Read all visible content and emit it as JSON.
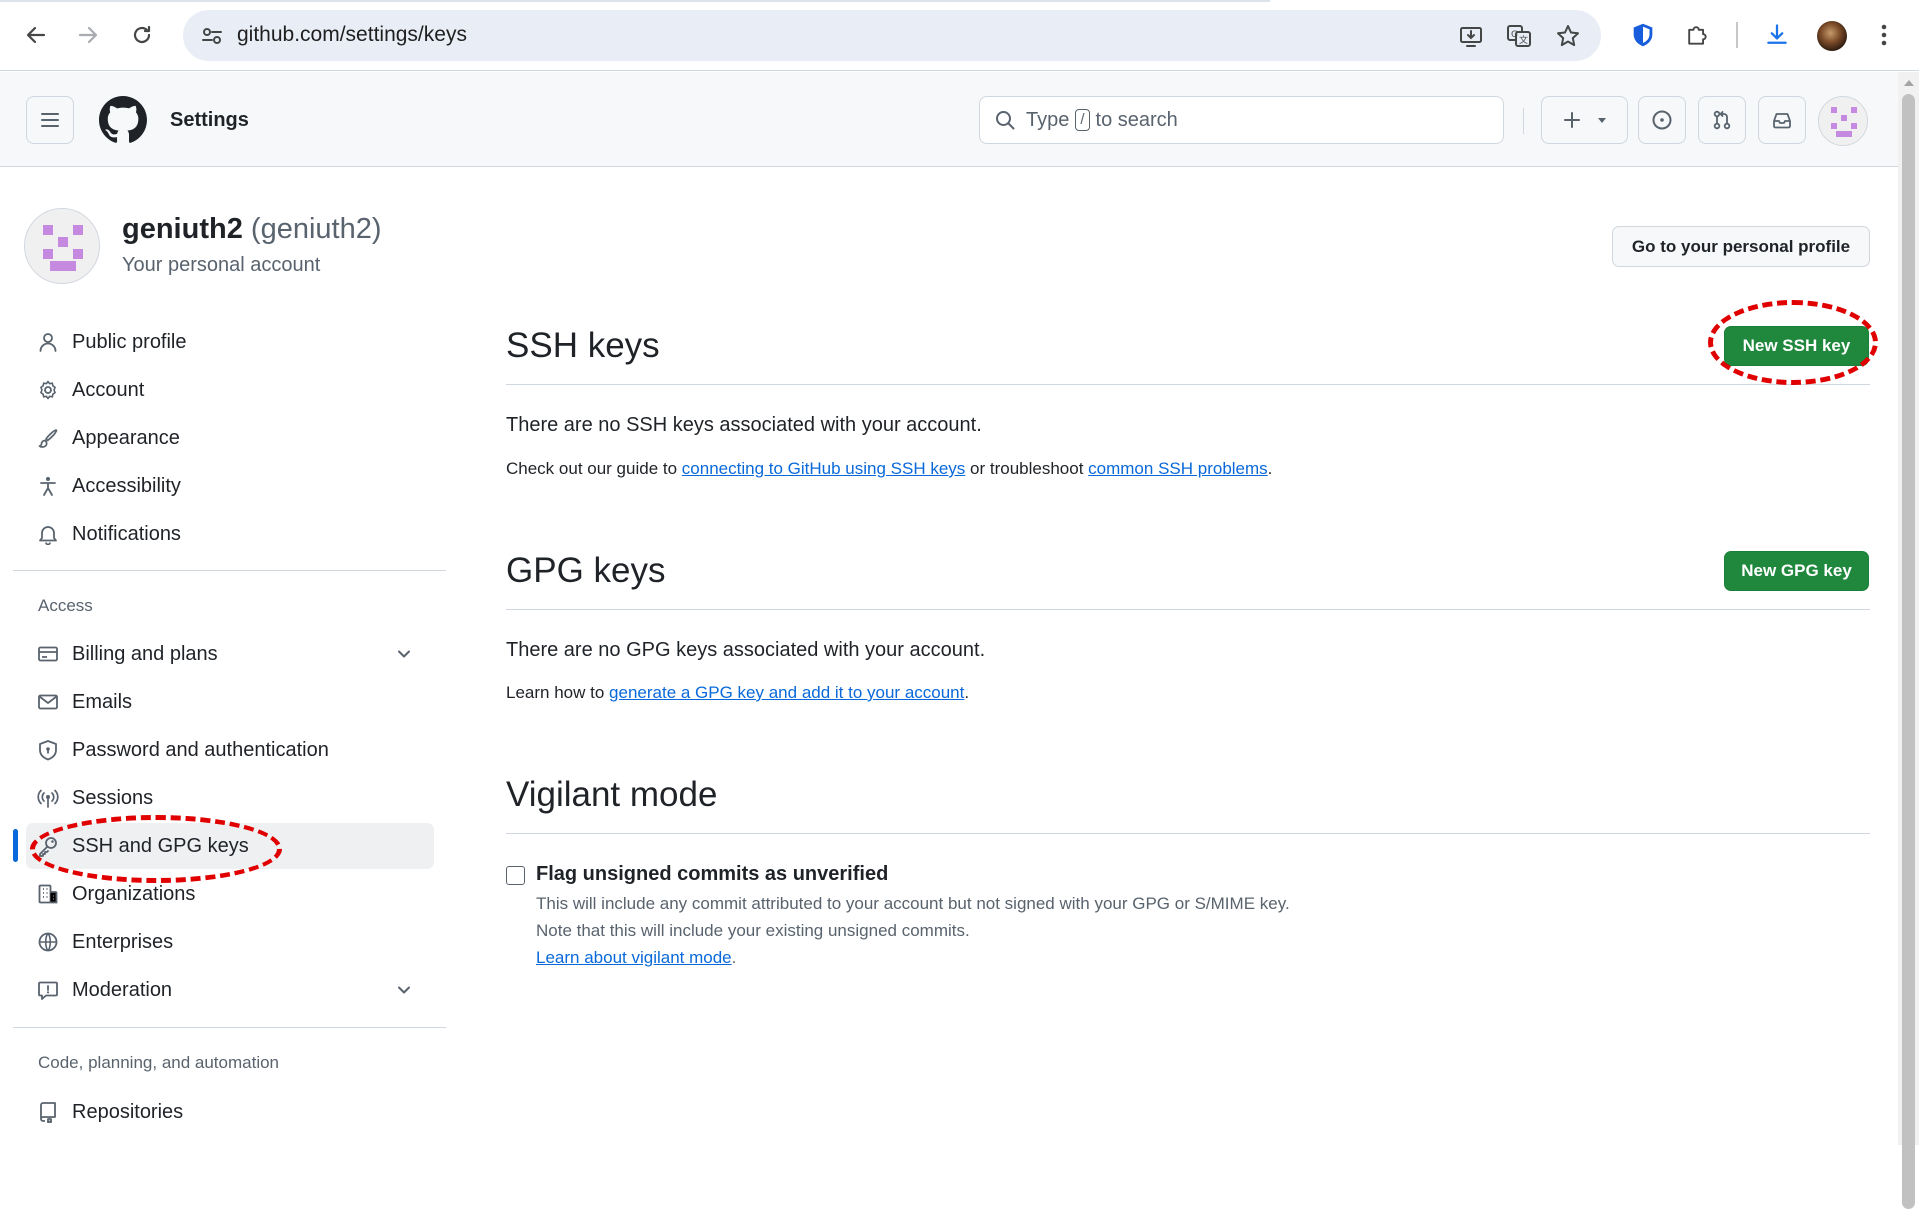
{
  "browser": {
    "url": "github.com/settings/keys"
  },
  "header": {
    "title": "Settings",
    "search_prefix": "Type",
    "search_key": "/",
    "search_suffix": "to search"
  },
  "account": {
    "name": "geniuth2",
    "login": "(geniuth2)",
    "subtitle": "Your personal account",
    "go_profile_label": "Go to your personal profile"
  },
  "sidebar": {
    "items": [
      {
        "label": "Public profile",
        "icon": "person-icon"
      },
      {
        "label": "Account",
        "icon": "gear-icon"
      },
      {
        "label": "Appearance",
        "icon": "paintbrush-icon"
      },
      {
        "label": "Accessibility",
        "icon": "accessibility-icon"
      },
      {
        "label": "Notifications",
        "icon": "bell-icon"
      }
    ],
    "access_heading": "Access",
    "access_items": [
      {
        "label": "Billing and plans",
        "icon": "credit-card-icon"
      },
      {
        "label": "Emails",
        "icon": "mail-icon"
      },
      {
        "label": "Password and authentication",
        "icon": "shield-lock-icon"
      },
      {
        "label": "Sessions",
        "icon": "broadcast-icon"
      },
      {
        "label": "SSH and GPG keys",
        "icon": "key-icon"
      },
      {
        "label": "Organizations",
        "icon": "organization-icon"
      },
      {
        "label": "Enterprises",
        "icon": "globe-icon"
      },
      {
        "label": "Moderation",
        "icon": "report-icon"
      }
    ],
    "code_heading": "Code, planning, and automation",
    "code_items": [
      {
        "label": "Repositories",
        "icon": "repo-icon"
      }
    ]
  },
  "ssh": {
    "title": "SSH keys",
    "new_button": "New SSH key",
    "empty_text": "There are no SSH keys associated with your account.",
    "guide_prefix": "Check out our guide to",
    "guide_link": "connecting to GitHub using SSH keys",
    "guide_middle": "or troubleshoot",
    "guide_link2": "common SSH problems",
    "guide_suffix": "."
  },
  "gpg": {
    "title": "GPG keys",
    "new_button": "New GPG key",
    "empty_text": "There are no GPG keys associated with your account.",
    "learn_prefix": "Learn how to",
    "learn_link": "generate a GPG key and add it to your account",
    "learn_suffix": "."
  },
  "vigilant": {
    "title": "Vigilant mode",
    "checkbox_label": "Flag unsigned commits as unverified",
    "checked": false,
    "note1": "This will include any commit attributed to your account but not signed with your GPG or S/MIME key.",
    "note2": "Note that this will include your existing unsigned commits.",
    "learn_link": "Learn about vigilant mode",
    "learn_suffix": "."
  },
  "colors": {
    "primary_button": "#1f883d",
    "link": "#0969da",
    "active_indicator": "#0969da",
    "annotation": "#e00000"
  }
}
